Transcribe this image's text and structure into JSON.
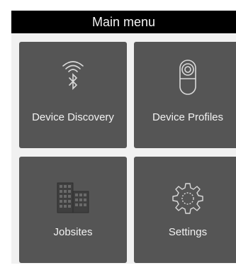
{
  "header": {
    "title": "Main menu"
  },
  "tiles": [
    {
      "label": "Device Discovery",
      "icon": "wireless-bluetooth-icon"
    },
    {
      "label": "Device Profiles",
      "icon": "device-profile-icon"
    },
    {
      "label": "Jobsites",
      "icon": "buildings-icon"
    },
    {
      "label": "Settings",
      "icon": "gear-icon"
    }
  ],
  "colors": {
    "header_bg": "#000000",
    "tile_bg": "#555555",
    "content_bg": "#f1f1f1",
    "text_light": "#f2f2f2"
  }
}
